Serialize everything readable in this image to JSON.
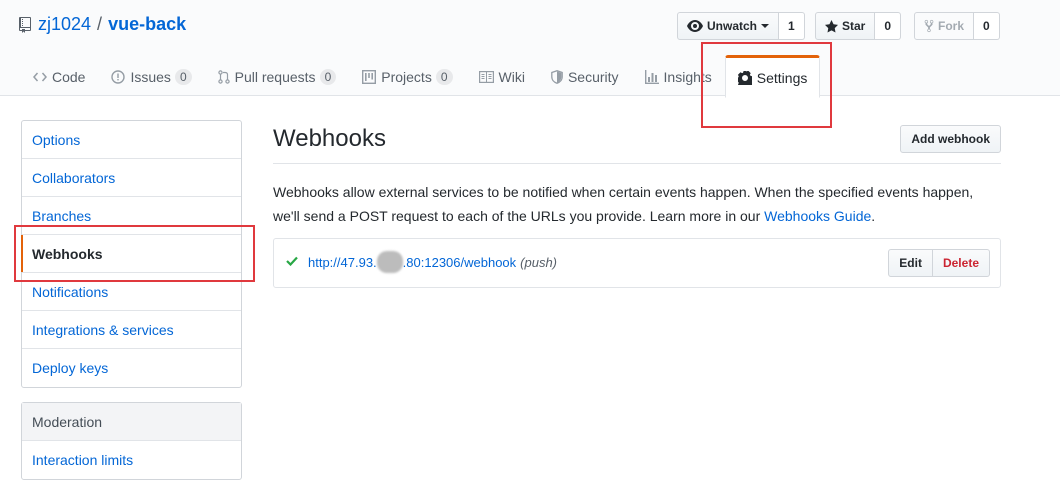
{
  "repo": {
    "owner": "zj1024",
    "separator": "/",
    "name": "vue-back"
  },
  "actions": {
    "watch_label": "Unwatch",
    "watch_count": "1",
    "star_label": "Star",
    "star_count": "0",
    "fork_label": "Fork",
    "fork_count": "0"
  },
  "tabs": [
    {
      "label": "Code",
      "icon": "code-icon"
    },
    {
      "label": "Issues",
      "counter": "0",
      "icon": "issue-icon"
    },
    {
      "label": "Pull requests",
      "counter": "0",
      "icon": "pull-request-icon"
    },
    {
      "label": "Projects",
      "counter": "0",
      "icon": "project-icon"
    },
    {
      "label": "Wiki",
      "icon": "book-icon"
    },
    {
      "label": "Security",
      "icon": "shield-icon"
    },
    {
      "label": "Insights",
      "icon": "graph-icon"
    },
    {
      "label": "Settings",
      "icon": "gear-icon",
      "selected": true
    }
  ],
  "sidebar": {
    "items": [
      "Options",
      "Collaborators",
      "Branches",
      "Webhooks",
      "Notifications",
      "Integrations & services",
      "Deploy keys"
    ],
    "selected": "Webhooks",
    "moderation_heading": "Moderation",
    "moderation_items": [
      "Interaction limits"
    ]
  },
  "main": {
    "title": "Webhooks",
    "add_button": "Add webhook",
    "description_1": "Webhooks allow external services to be notified when certain events happen. When the specified events happen, we'll send a POST request to each of the URLs you provide. Learn more in our ",
    "guide_link": "Webhooks Guide",
    "description_end": "."
  },
  "hook": {
    "url_prefix": "http://47.93.",
    "url_suffix": ".80:12306/webhook",
    "events": "(push)",
    "edit_label": "Edit",
    "delete_label": "Delete"
  },
  "colors": {
    "link": "#0366d6",
    "selected_accent": "#e36209",
    "annotation": "#e0393e",
    "success": "#28a745",
    "danger": "#cb2431"
  }
}
